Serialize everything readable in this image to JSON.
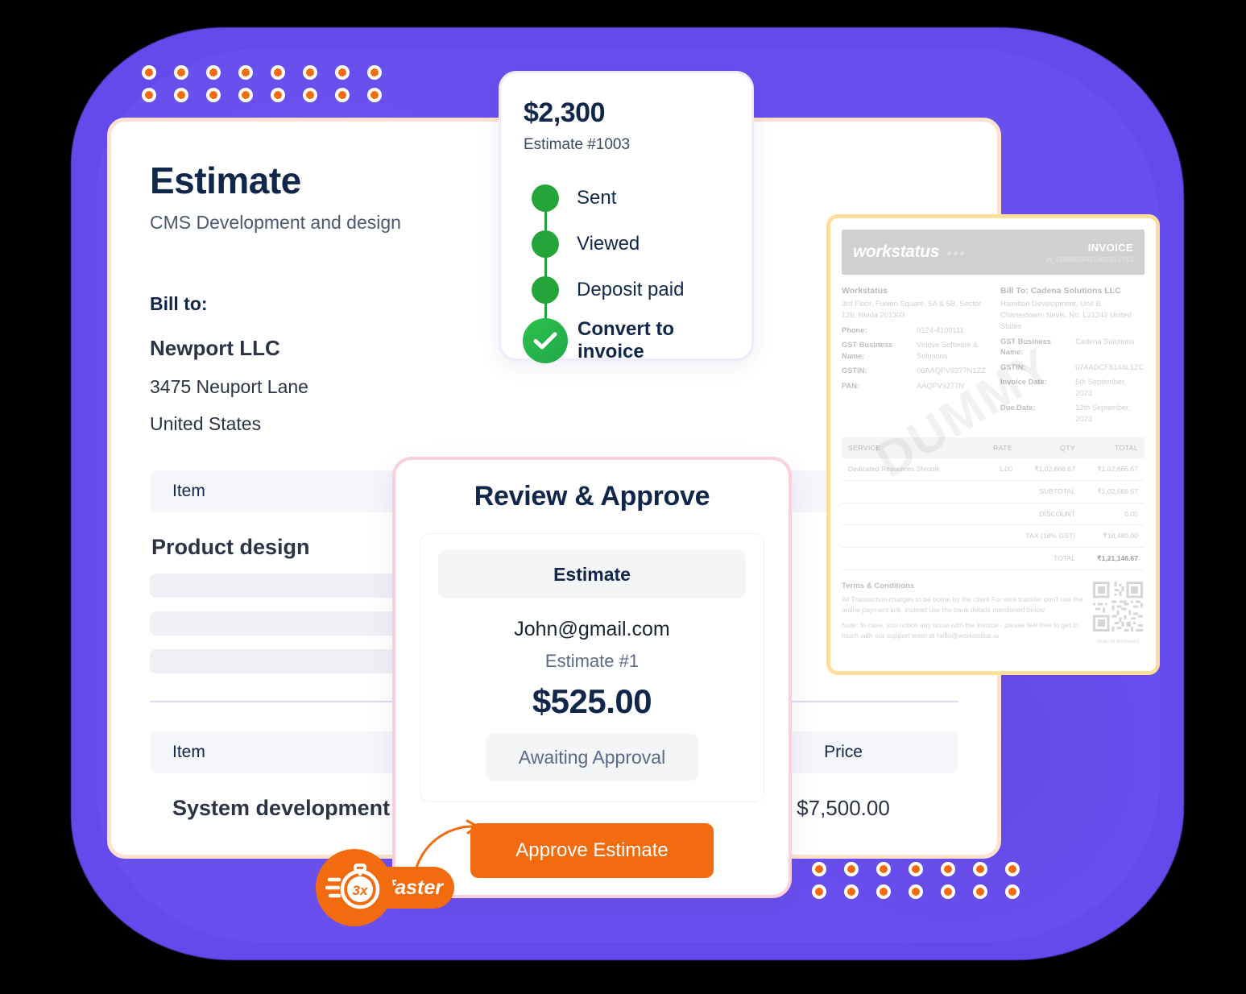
{
  "theme": {
    "purple": "#6449ec",
    "orange": "#f26b0f",
    "green": "#24a53a",
    "navy": "#10264a",
    "card_border_peach": "#fde3cf",
    "card_border_pink": "#fbd0dc",
    "card_border_amber": "#fcdf9c"
  },
  "estimate_doc": {
    "title": "Estimate",
    "subtitle": "CMS Development and design",
    "bill_to_label": "Bill to:",
    "bill_to": {
      "name": "Newport LLC",
      "address_line1": "3475 Neuport Lane",
      "address_line2": "United States"
    },
    "table1": {
      "headers": {
        "item": "Item",
        "price": ""
      },
      "row_name": "Product design"
    },
    "table2": {
      "headers": {
        "item": "Item",
        "price": "Price"
      },
      "row_name": "System development",
      "row_price": "$7,500.00"
    }
  },
  "status_card": {
    "amount": "$2,300",
    "estimate_number": "Estimate #1003",
    "steps": [
      {
        "label": "Sent",
        "state": "done"
      },
      {
        "label": "Viewed",
        "state": "done"
      },
      {
        "label": "Deposit paid",
        "state": "done"
      },
      {
        "label": "Convert to invoice",
        "state": "current"
      }
    ]
  },
  "review_card": {
    "title": "Review & Approve",
    "doc_type": "Estimate",
    "email": "John@gmail.com",
    "estimate_number": "Estimate #1",
    "amount": "$525.00",
    "status": "Awaiting Approval",
    "approve_button": "Approve Estimate"
  },
  "invoice_preview": {
    "logo": "workstatus",
    "doc_label": "INVOICE",
    "doc_number": "in_1648565545166236 1712",
    "seller": {
      "name": "Workstatus",
      "address": "3rd Floor, Fusion Square, 5A & 5B, Sector 126, Noida 201303",
      "fields": [
        {
          "key": "Phone:",
          "value": "0124-4100111"
        },
        {
          "key": "GST Business Name:",
          "value": "Vinove Software & Solutions"
        },
        {
          "key": "GSTIN:",
          "value": "06AAQFV9277N1ZZ"
        },
        {
          "key": "PAN:",
          "value": "AAQFV9277N"
        }
      ]
    },
    "buyer": {
      "name": "Bill To: Cadena Solutions LLC",
      "address": "Hamilton Development, Unit B, Charlestown, Nevis, No. L21242 United States",
      "fields": [
        {
          "key": "GST Business Name:",
          "value": "Cadena Solutions"
        },
        {
          "key": "GSTIN:",
          "value": "07AADCF8144L1ZC"
        },
        {
          "key": "Invoice Date:",
          "value": "5th September, 2023"
        },
        {
          "key": "Due Date:",
          "value": "12th September, 2023"
        }
      ]
    },
    "table": {
      "headers": [
        "SERVICE",
        "RATE",
        "QTY",
        "TOTAL"
      ],
      "rows": [
        {
          "service": "Dedicated Resources Shronik",
          "rate": "1.00",
          "qty": "₹1,02,666.67",
          "total": "₹1,02,666.67"
        }
      ],
      "summary": [
        {
          "label": "SUBTOTAL",
          "value": "₹1,02,666.67"
        },
        {
          "label": "DISCOUNT",
          "value": "0.00"
        },
        {
          "label": "TAX (18% GST)",
          "value": "₹18,480.00"
        },
        {
          "label": "TOTAL",
          "value": "₹1,21,146.67"
        }
      ]
    },
    "watermark": "DUMMY",
    "terms": {
      "heading": "Terms & Conditions",
      "body": "All Transaction charges to be borne by the client For wire transfer don't use the online payment link, instead use the bank details mentioned below",
      "note": "Note: In case, you notice any issue with the invoice - please feel free to get in touch with our support team at hello@workstatus.io"
    },
    "qr_caption": "Scan to download"
  },
  "badge": {
    "multiplier": "3x",
    "word": "faster"
  }
}
